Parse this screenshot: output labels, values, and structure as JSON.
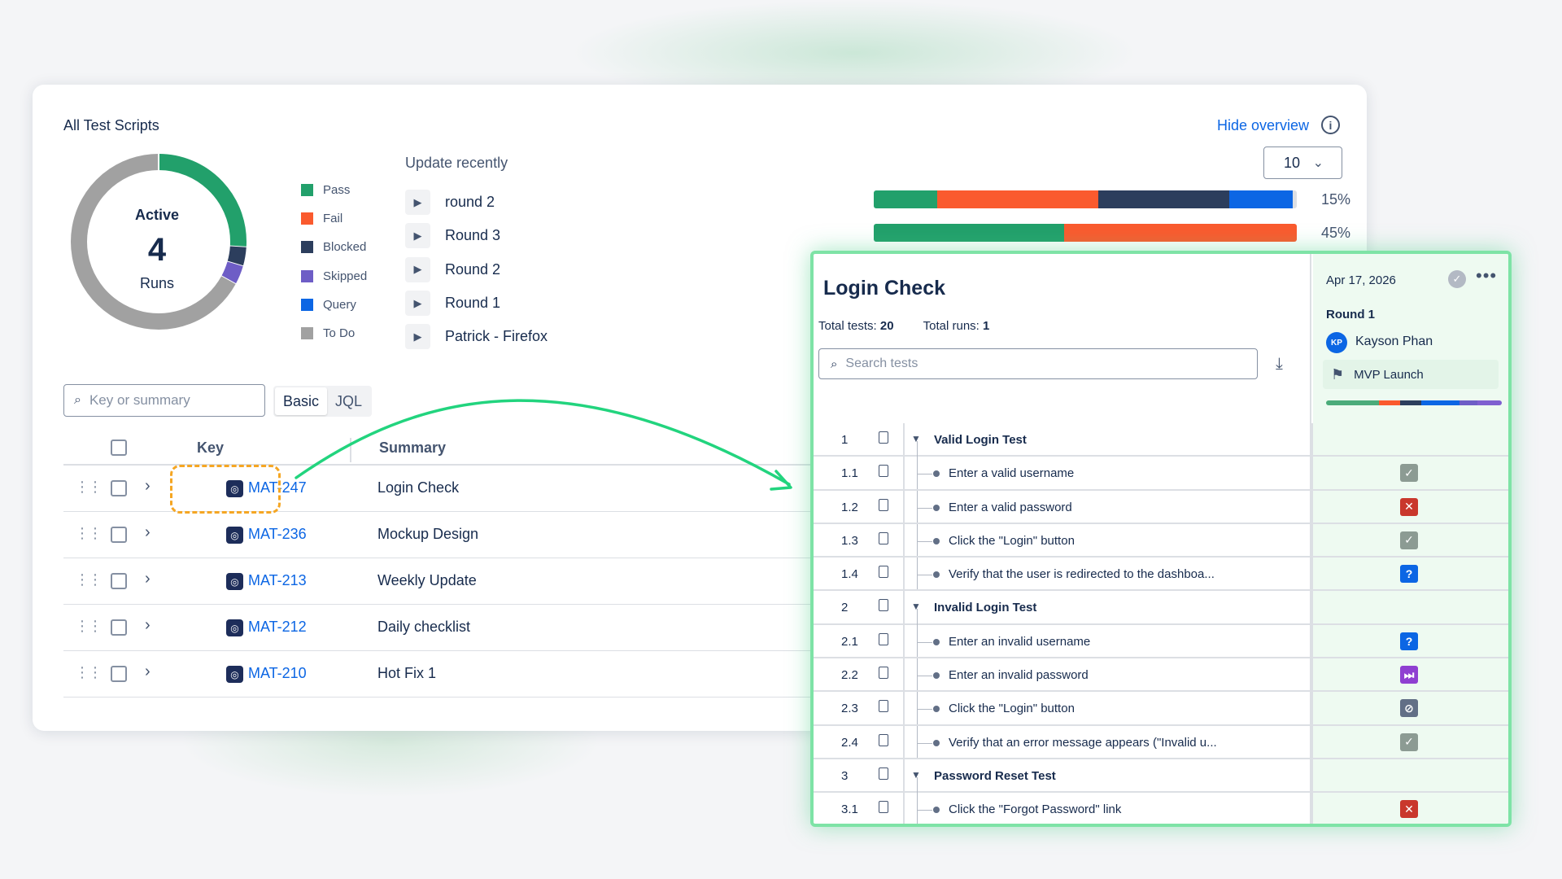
{
  "overview": {
    "title": "All Test Scripts",
    "hide_overview": "Hide overview",
    "info_glyph": "i",
    "donut": {
      "label": "Active",
      "count": "4",
      "unit": "Runs",
      "segments": [
        {
          "name": "Pass",
          "fraction": 0.26,
          "color": "#22a06b"
        },
        {
          "name": "Blocked",
          "fraction": 0.035,
          "color": "#2c3e5d"
        },
        {
          "name": "Skipped",
          "fraction": 0.035,
          "color": "#6e5dc6"
        },
        {
          "name": "To Do",
          "fraction": 0.67,
          "color": "#a1a1a1"
        }
      ]
    },
    "legend": [
      {
        "label": "Pass",
        "color": "#22a06b"
      },
      {
        "label": "Fail",
        "color": "#fa5a2e"
      },
      {
        "label": "Blocked",
        "color": "#2c3e5d"
      },
      {
        "label": "Skipped",
        "color": "#6e5dc6"
      },
      {
        "label": "Query",
        "color": "#0c66e4"
      },
      {
        "label": "To Do",
        "color": "#a1a1a1"
      }
    ],
    "recent": {
      "title": "Update recently",
      "page_size": "10",
      "play_glyph": "▶",
      "items": [
        "round 2",
        "Round 3",
        "Round 2",
        "Round 1",
        "Patrick - Firefox"
      ]
    },
    "progress": [
      {
        "percent": "15%",
        "segments": [
          {
            "value": 15,
            "color": "#22a06b"
          },
          {
            "value": 38,
            "color": "#fa5a2e"
          },
          {
            "value": 31,
            "color": "#2c3e5d"
          },
          {
            "value": 15,
            "color": "#0c66e4"
          },
          {
            "value": 1,
            "color": "#dcdfe4"
          }
        ]
      },
      {
        "percent": "45%",
        "segments": [
          {
            "value": 45,
            "color": "#22a06b"
          },
          {
            "value": 55,
            "color": "#fa5a2e"
          }
        ]
      }
    ]
  },
  "filters": {
    "search_placeholder": "Key or summary",
    "mode_basic": "Basic",
    "mode_jql": "JQL"
  },
  "table": {
    "col_key": "Key",
    "col_summary": "Summary",
    "rows": [
      {
        "key": "MAT-247",
        "summary": "Login Check"
      },
      {
        "key": "MAT-236",
        "summary": "Mockup Design"
      },
      {
        "key": "MAT-213",
        "summary": "Weekly Update"
      },
      {
        "key": "MAT-212",
        "summary": "Daily checklist"
      },
      {
        "key": "MAT-210",
        "summary": "Hot Fix 1"
      }
    ]
  },
  "panel": {
    "title": "Login Check",
    "total_tests_label": "Total tests:",
    "total_tests": "20",
    "total_runs_label": "Total runs:",
    "total_runs": "1",
    "search_placeholder": "Search tests",
    "run": {
      "date": "Apr 17, 2026",
      "name": "Round 1",
      "assignee_initials": "KP",
      "assignee": "Kayson Phan",
      "release": "MVP Launch",
      "bar": [
        {
          "value": 30,
          "color": "#4bab7a"
        },
        {
          "value": 12,
          "color": "#fa5a2e"
        },
        {
          "value": 12,
          "color": "#2c3e5d"
        },
        {
          "value": 22,
          "color": "#0c66e4"
        },
        {
          "value": 10,
          "color": "#6e5dc6"
        },
        {
          "value": 14,
          "color": "#7f5fd0"
        }
      ]
    },
    "steps": [
      {
        "num": "1",
        "title": "Valid Login Test",
        "group": true,
        "status": ""
      },
      {
        "num": "1.1",
        "title": "Enter a valid username",
        "group": false,
        "status": "pass"
      },
      {
        "num": "1.2",
        "title": "Enter a valid password",
        "group": false,
        "status": "fail"
      },
      {
        "num": "1.3",
        "title": "Click the \"Login\" button",
        "group": false,
        "status": "pass"
      },
      {
        "num": "1.4",
        "title": "Verify that the user is redirected to the dashboa...",
        "group": false,
        "status": "query"
      },
      {
        "num": "2",
        "title": "Invalid Login Test",
        "group": true,
        "status": ""
      },
      {
        "num": "2.1",
        "title": "Enter an invalid username",
        "group": false,
        "status": "query"
      },
      {
        "num": "2.2",
        "title": "Enter an invalid password",
        "group": false,
        "status": "skipped"
      },
      {
        "num": "2.3",
        "title": "Click the \"Login\" button",
        "group": false,
        "status": "blocked"
      },
      {
        "num": "2.4",
        "title": "Verify that an error message appears (\"Invalid u...",
        "group": false,
        "status": "pass"
      },
      {
        "num": "3",
        "title": "Password Reset Test",
        "group": true,
        "status": ""
      },
      {
        "num": "3.1",
        "title": "Click the \"Forgot Password\" link",
        "group": false,
        "status": "fail"
      }
    ]
  }
}
